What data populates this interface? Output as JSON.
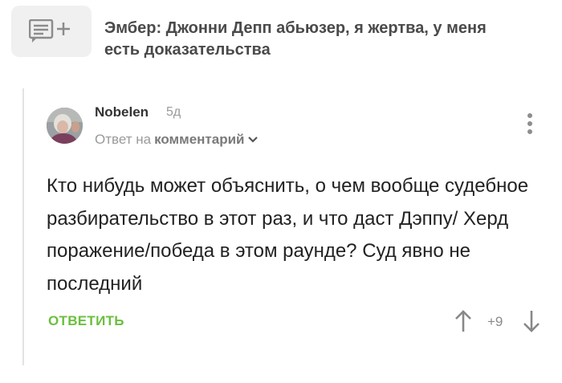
{
  "post": {
    "title": "Эмбер: Джонни Депп абьюзер, я жертва, у меня есть доказательства",
    "thumbnail_icon": "text-story-plus-icon"
  },
  "comment": {
    "username": "Nobelen",
    "time": "5д",
    "reply_prefix": "Ответ на",
    "reply_target": "комментарий",
    "body": "Кто нибудь может объяснить, о чем вообще судебное разбирательство в этот раз, и что даст Дэппу/ Херд поражение/победа в этом раунде? Суд явно не последний",
    "reply_label": "ОТВЕТИТЬ",
    "rating": "+9"
  },
  "colors": {
    "accent_green": "#6bbf3f",
    "muted_gray": "#9a9a9a",
    "thread_line": "#e3e3e3"
  }
}
